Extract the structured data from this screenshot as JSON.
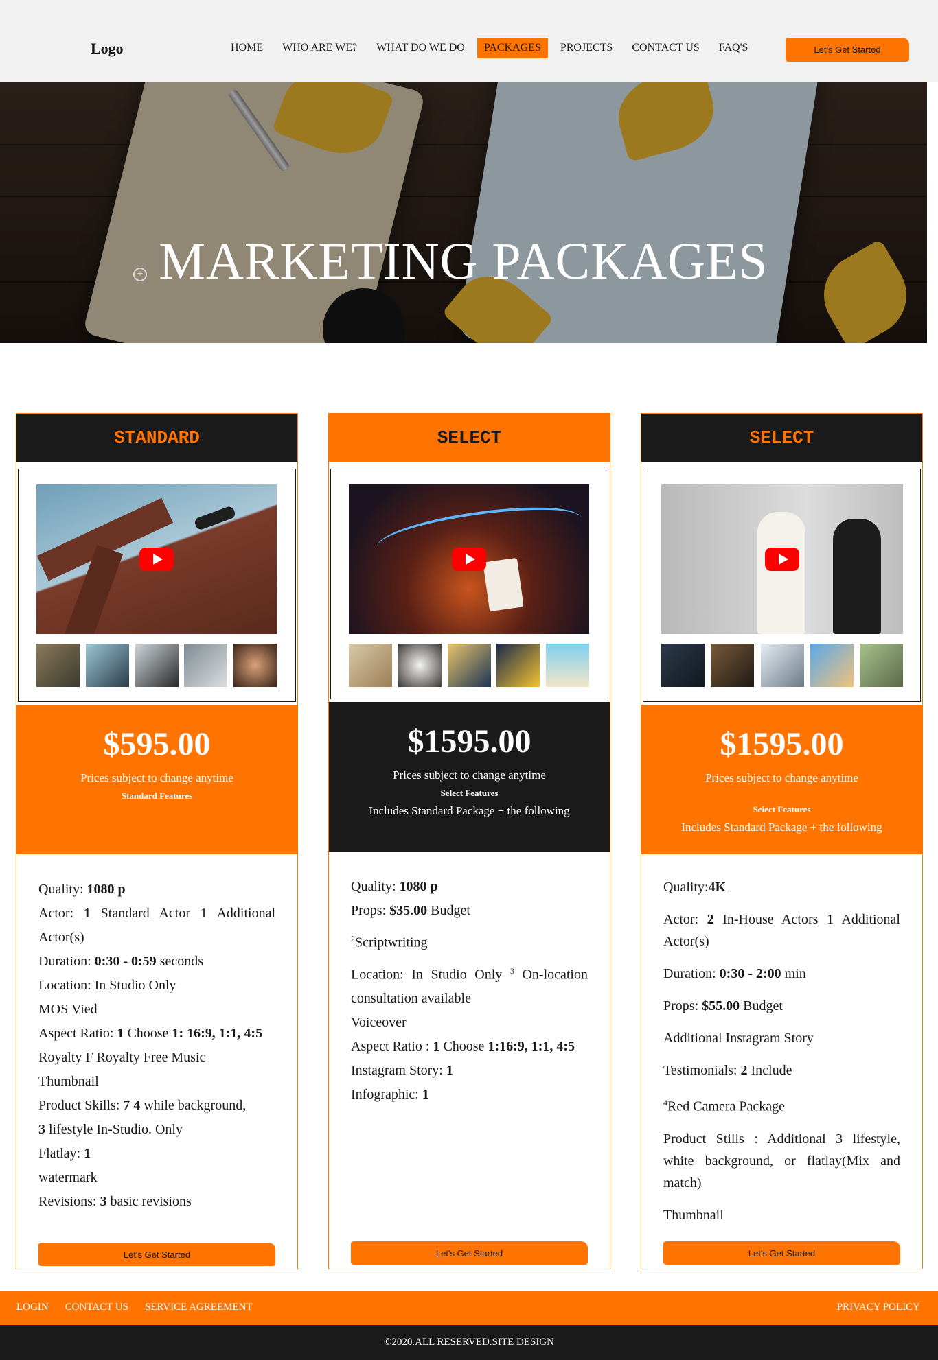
{
  "header": {
    "logo": "Logo",
    "nav": [
      {
        "label": "HOME"
      },
      {
        "label": "WHO ARE WE?"
      },
      {
        "label": "WHAT DO WE DO"
      },
      {
        "label": "PACKAGES",
        "active": true
      },
      {
        "label": "PROJECTS"
      },
      {
        "label": "CONTACT US"
      },
      {
        "label": "FAQ'S"
      }
    ],
    "cta": "Let's Get Started"
  },
  "hero": {
    "title": "MARKETING PACKAGES"
  },
  "cards": [
    {
      "title": "STANDARD",
      "price": "$595.00",
      "note": "Prices subject to change anytime",
      "features_title": "Standard Features",
      "includes": "",
      "cta": "Let's Get Started",
      "features": [
        {
          "pre": "Quality: ",
          "b1": "1080 p",
          "post": ""
        },
        {
          "pre": "Actor: ",
          "b1": "1",
          "post": " Standard Actor 1 Additional Actor(s)"
        },
        {
          "pre": "Duration: ",
          "b1": "0:30",
          "mid": " - ",
          "b2": "0:59",
          "post": " seconds"
        },
        {
          "pre": "Location: In Studio Only"
        },
        {
          "pre": "MOS Vied"
        },
        {
          "pre": "Aspect Ratio: ",
          "b1": "1",
          "mid": " Choose ",
          "b2": "1: 16:9, 1:1, 4:5"
        },
        {
          "pre": "Royalty F Royalty Free Music"
        },
        {
          "pre": "Thumbnail"
        },
        {
          "pre": "Product Skills: ",
          "b1": "7 4",
          "post": " while background, "
        },
        {
          "pre": "",
          "b1": "3",
          "post": " lifestyle In-Studio. Only"
        },
        {
          "pre": "Flatlay: ",
          "b1": "1"
        },
        {
          "pre": "watermark"
        },
        {
          "pre": "Revisions: ",
          "b1": "3",
          "post": " basic revisions"
        }
      ]
    },
    {
      "title": "SELECT",
      "price": "$1595.00",
      "note": "Prices subject to change anytime",
      "features_title": "Select Features",
      "includes": "Includes Standard Package + the following",
      "cta": "Let's Get Started",
      "features": [
        {
          "pre": "Quality: ",
          "b1": "1080 p"
        },
        {
          "pre": "Props: ",
          "b1": "$35.00",
          "post": " Budget"
        },
        {
          "sup": "2",
          "pre": "Scriptwriting"
        },
        {
          "pre": "Location: In Studio Only ",
          "sup2": "3",
          "post": " On-location consultation available"
        },
        {
          "pre": "Voiceover"
        },
        {
          "pre": "Aspect Ratio : ",
          "b1": "1",
          "mid": " Choose ",
          "b2": "1:16:9, 1:1, 4:5"
        },
        {
          "pre": "Instagram Story: ",
          "b1": "1"
        },
        {
          "pre": "Infographic: ",
          "b1": "1"
        }
      ]
    },
    {
      "title": "SELECT",
      "price": "$1595.00",
      "note": "Prices subject to change anytime",
      "features_title": "Select Features",
      "includes": "Includes Standard Package + the following",
      "cta": "Let's Get Started",
      "features": [
        {
          "pre": "Quality:",
          "b1": "4K"
        },
        {
          "pre": "Actor: ",
          "b1": "2",
          "post": " In-House Actors 1 Additional Actor(s)"
        },
        {
          "pre": "Duration: ",
          "b1": "0:30",
          "mid": " - ",
          "b2": "2:00",
          "post": " min"
        },
        {
          "pre": "Props: ",
          "b1": "$55.00",
          "post": " Budget"
        },
        {
          "pre": "Additional Instagram Story"
        },
        {
          "pre": "Testimonials: ",
          "b1": "2",
          "post": " Include"
        },
        {
          "sup": "4",
          "pre": "Red Camera Package"
        },
        {
          "pre": "Product Stills : Additional 3 lifestyle, white background, or flatlay(Mix and match)"
        },
        {
          "pre": "Thumbnail"
        }
      ]
    }
  ],
  "footer": {
    "links": [
      "LOGIN",
      "CONTACT US",
      "SERVICE AGREEMENT"
    ],
    "right": "PRIVACY POLICY",
    "copyright": "©2020.ALL RESERVED.SITE DESIGN"
  },
  "colors": {
    "accent": "#ff7300",
    "dark": "#1a1a1a"
  }
}
